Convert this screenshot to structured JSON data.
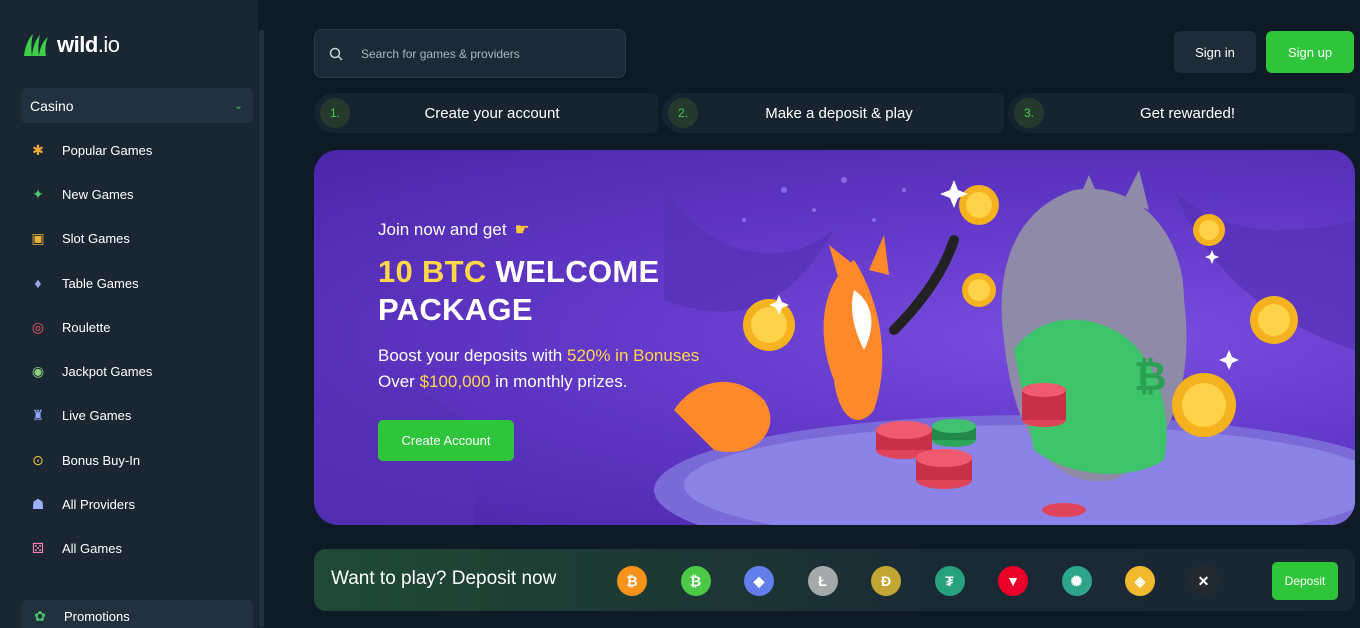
{
  "brand": {
    "name": "wild",
    "suffix": ".io"
  },
  "search": {
    "placeholder": "Search for games & providers"
  },
  "auth": {
    "signin_label": "Sign in",
    "signup_label": "Sign up"
  },
  "sidebar": {
    "category": "Casino",
    "items": [
      {
        "label": "Popular Games",
        "icon": "star-icon"
      },
      {
        "label": "New Games",
        "icon": "sparkle-icon"
      },
      {
        "label": "Slot Games",
        "icon": "slot-machine-icon"
      },
      {
        "label": "Table Games",
        "icon": "cards-icon"
      },
      {
        "label": "Roulette",
        "icon": "roulette-icon"
      },
      {
        "label": "Jackpot Games",
        "icon": "jackpot-icon"
      },
      {
        "label": "Live Games",
        "icon": "live-icon"
      },
      {
        "label": "Bonus Buy-In",
        "icon": "bonus-icon"
      },
      {
        "label": "All Providers",
        "icon": "providers-icon"
      },
      {
        "label": "All Games",
        "icon": "dice-icon"
      }
    ],
    "promotions_label": "Promotions"
  },
  "steps": [
    {
      "num": "1.",
      "label": "Create your account"
    },
    {
      "num": "2.",
      "label": "Make a deposit & play"
    },
    {
      "num": "3.",
      "label": "Get rewarded!"
    }
  ],
  "banner": {
    "kicker": "Join now and get",
    "title_highlight": "10 BTC",
    "title_line1_rest": " WELCOME",
    "title_line2": "PACKAGE",
    "sub_line1_prefix": "Boost your deposits with ",
    "sub_line1_highlight": "520% in Bonuses",
    "sub_line2_prefix": "Over ",
    "sub_line2_highlight": "$100,000",
    "sub_line2_suffix": " in monthly prizes.",
    "cta_label": "Create Account"
  },
  "deposit": {
    "text": "Want to play? Deposit now",
    "button_label": "Deposit",
    "coins": [
      {
        "name": "bitcoin",
        "glyph": "₿",
        "color": "#f7931a"
      },
      {
        "name": "bitcoin-cash",
        "glyph": "₿",
        "color": "#4cc947"
      },
      {
        "name": "ethereum",
        "glyph": "◆",
        "color": "#627eea"
      },
      {
        "name": "litecoin",
        "glyph": "Ł",
        "color": "#a6a9aa"
      },
      {
        "name": "dogecoin",
        "glyph": "Ð",
        "color": "#c2a633"
      },
      {
        "name": "tether",
        "glyph": "₮",
        "color": "#26a17b"
      },
      {
        "name": "tron",
        "glyph": "▼",
        "color": "#eb0029"
      },
      {
        "name": "cardano",
        "glyph": "✺",
        "color": "#2ea58a"
      },
      {
        "name": "binance-coin",
        "glyph": "◈",
        "color": "#f3ba2f"
      },
      {
        "name": "ripple",
        "glyph": "✕",
        "color": "#23292f"
      }
    ]
  },
  "colors": {
    "accent": "#2fc53a",
    "highlight": "#ffd84a",
    "sidebar": "#1a2733",
    "background": "#0e1b26"
  }
}
